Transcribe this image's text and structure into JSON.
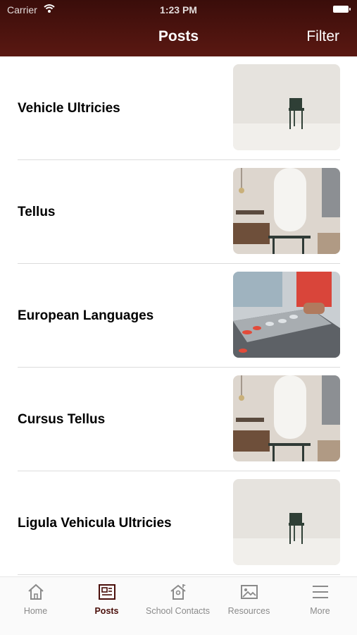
{
  "status_bar": {
    "carrier": "Carrier",
    "time": "1:23 PM"
  },
  "nav": {
    "title": "Posts",
    "filter_label": "Filter"
  },
  "posts": [
    {
      "title": "Vehicle Ultricies",
      "image": "chair-photo"
    },
    {
      "title": "Tellus",
      "image": "cafe-interior-photo"
    },
    {
      "title": "European Languages",
      "image": "arcade-game-photo"
    },
    {
      "title": "Cursus Tellus",
      "image": "cafe-interior-photo"
    },
    {
      "title": "Ligula Vehicula Ultricies",
      "image": "chair-photo"
    }
  ],
  "tabs": [
    {
      "label": "Home",
      "icon": "home-icon",
      "active": false
    },
    {
      "label": "Posts",
      "icon": "newspaper-icon",
      "active": true
    },
    {
      "label": "School Contacts",
      "icon": "school-house-icon",
      "active": false
    },
    {
      "label": "Resources",
      "icon": "image-icon",
      "active": false
    },
    {
      "label": "More",
      "icon": "hamburger-menu-icon",
      "active": false
    }
  ],
  "colors": {
    "header": "#4a120d",
    "active_tab": "#4a0f0a",
    "inactive_tab": "#8a8a8a"
  }
}
